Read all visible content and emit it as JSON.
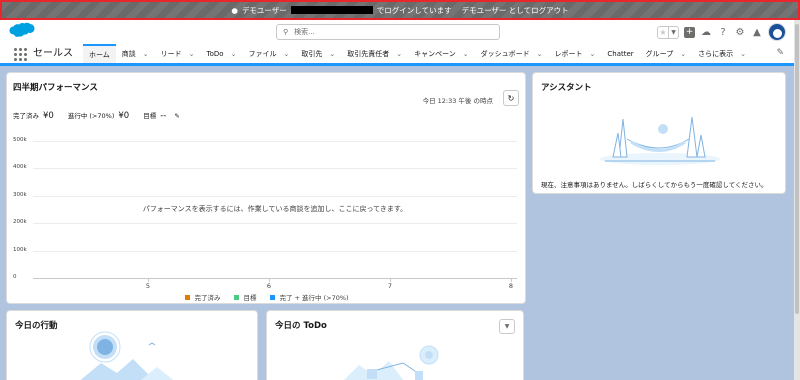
{
  "banner": {
    "prefix": "デモユーザー",
    "middle": "でログインしています",
    "logout_link": "デモユーザー としてログアウト"
  },
  "header": {
    "search_placeholder": "検索...",
    "help": "?"
  },
  "nav": {
    "app_name": "セールス",
    "tabs": [
      {
        "label": "ホーム",
        "has_menu": false
      },
      {
        "label": "商談",
        "has_menu": true
      },
      {
        "label": "リード",
        "has_menu": true
      },
      {
        "label": "ToDo",
        "has_menu": true
      },
      {
        "label": "ファイル",
        "has_menu": true
      },
      {
        "label": "取引先",
        "has_menu": true
      },
      {
        "label": "取引先責任者",
        "has_menu": true
      },
      {
        "label": "キャンペーン",
        "has_menu": true
      },
      {
        "label": "ダッシュボード",
        "has_menu": true
      },
      {
        "label": "レポート",
        "has_menu": true
      },
      {
        "label": "Chatter",
        "has_menu": false
      },
      {
        "label": "グループ",
        "has_menu": true
      },
      {
        "label": "さらに表示",
        "has_menu": true
      }
    ]
  },
  "performance": {
    "title": "四半期パフォーマンス",
    "as_of": "今日 12:33 午後 の時点",
    "closed_label": "完了済み",
    "closed_value": "¥0",
    "open_label": "進行中 (>70%)",
    "open_value": "¥0",
    "goal_label": "目標",
    "goal_value": "--",
    "empty_message": "パフォーマンスを表示するには、作業している商談を追加し、ここに戻ってきます。"
  },
  "chart_data": {
    "type": "line",
    "title": "",
    "xlabel": "",
    "ylabel": "",
    "x_ticks": [
      "5",
      "6",
      "7",
      "8"
    ],
    "xlim": [
      4.05,
      8.05
    ],
    "y_ticks": [
      "500k",
      "400k",
      "300k",
      "200k",
      "100k",
      "0"
    ],
    "y_tick_values": [
      500000,
      400000,
      300000,
      200000,
      100000,
      0
    ],
    "ylim": [
      0,
      500000
    ],
    "grid": true,
    "legend_position": "bottom",
    "series": [
      {
        "name": "完了済み",
        "color": "#e07c00",
        "values": []
      },
      {
        "name": "目標",
        "color": "#4bca81",
        "values": []
      },
      {
        "name": "完了 + 進行中 (>70%)",
        "color": "#1b96ff",
        "values": []
      }
    ]
  },
  "assistant": {
    "title": "アシスタント",
    "message": "現在、注意事項はありません。しばらくしてからもう一度確認してください。"
  },
  "events": {
    "title": "今日の行動"
  },
  "todo": {
    "title": "今日の ToDo"
  }
}
